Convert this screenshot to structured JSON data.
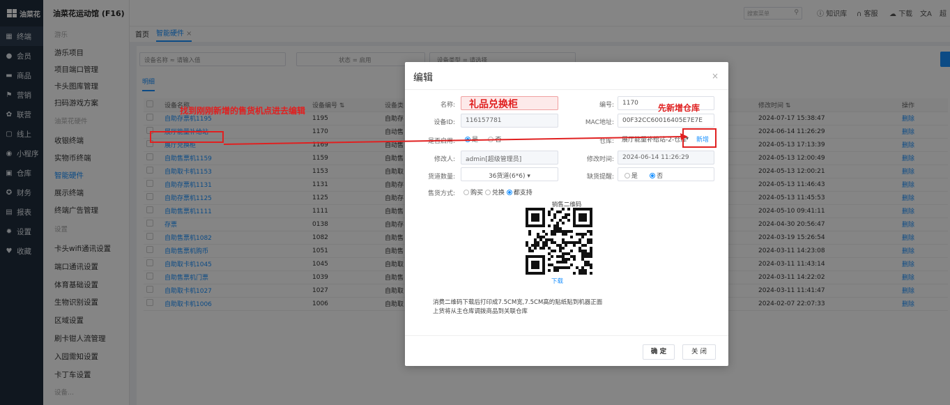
{
  "brand": {
    "name": "油菜花",
    "venue": "油菜花运动馆 (F16)"
  },
  "nav": [
    {
      "icon": "▦",
      "label": "终端"
    },
    {
      "icon": "●",
      "label": "会员"
    },
    {
      "icon": "▬",
      "label": "商品"
    },
    {
      "icon": "⚑",
      "label": "营销"
    },
    {
      "icon": "✿",
      "label": "联营"
    },
    {
      "icon": "▢",
      "label": "线上"
    },
    {
      "icon": "◉",
      "label": "小程序"
    },
    {
      "icon": "▣",
      "label": "仓库"
    },
    {
      "icon": "✪",
      "label": "财务"
    },
    {
      "icon": "▤",
      "label": "报表"
    },
    {
      "icon": "✹",
      "label": "设置"
    },
    {
      "icon": "♥",
      "label": "收藏"
    }
  ],
  "submenu": {
    "g1": "游乐",
    "g1_items": [
      "游乐项目",
      "项目端口管理",
      "卡头图库管理",
      "扫码游戏方案"
    ],
    "g2": "油菜花硬件",
    "g2_items": [
      "收银终端",
      "实物币终端",
      "智能硬件",
      "展示终端",
      "终端广告管理"
    ],
    "g3": "设置",
    "g3_items": [
      "卡头wifi通讯设置",
      "端口通讯设置",
      "体育基础设置",
      "生物识别设置",
      "区域设置",
      "刷卡钳人流管理",
      "入园需知设置",
      "卡丁车设置"
    ],
    "g4": "设备..."
  },
  "topbar": {
    "search_placeholder": "搜索菜单",
    "knowledge": "知识库",
    "service": "客服",
    "download": "下载",
    "extra": "超"
  },
  "tabs": [
    {
      "label": "首页"
    },
    {
      "label": "智能硬件"
    }
  ],
  "filters": {
    "name_label": "设备名称",
    "op1": "≈",
    "name_placeholder": "请输入值",
    "status_label": "状态",
    "op2": "=",
    "status_value": "启用",
    "type_label": "设备类型",
    "op3": "=",
    "type_placeholder": "请选择"
  },
  "subtab": "明细",
  "table": {
    "headers": [
      "",
      "设备名称",
      "设备编号 ⇅",
      "设备类",
      "修改时间 ⇅",
      "操作"
    ],
    "rows": [
      {
        "name": "自助存票机1195",
        "code": "1195",
        "type": "自助存",
        "time": "2024-07-17 15:38:47",
        "op": "删除"
      },
      {
        "name": "展厅能量补给站",
        "code": "1170",
        "type": "自动售",
        "time": "2024-06-14 11:26:29",
        "op": "删除"
      },
      {
        "name": "展厅兑换柜",
        "code": "1169",
        "type": "自动售",
        "time": "2024-05-13 17:13:39",
        "op": "删除"
      },
      {
        "name": "自助售票机1159",
        "code": "1159",
        "type": "自助售",
        "time": "2024-05-13 12:00:49",
        "op": "删除"
      },
      {
        "name": "自助取卡机1153",
        "code": "1153",
        "type": "自助取",
        "time": "2024-05-13 12:00:21",
        "op": "删除"
      },
      {
        "name": "自助存票机1131",
        "code": "1131",
        "type": "自助存",
        "time": "2024-05-13 11:46:43",
        "op": "删除"
      },
      {
        "name": "自助存票机1125",
        "code": "1125",
        "type": "自助存",
        "time": "2024-05-13 11:45:53",
        "op": "删除"
      },
      {
        "name": "自助售票机1111",
        "code": "1111",
        "type": "自助售",
        "time": "2024-05-10 09:41:11",
        "op": "删除"
      },
      {
        "name": "存票",
        "code": "0138",
        "type": "自助存",
        "time": "2024-04-30 20:56:47",
        "op": "删除"
      },
      {
        "name": "自助售票机1082",
        "code": "1082",
        "type": "自助售",
        "time": "2024-03-19 15:26:54",
        "op": "删除"
      },
      {
        "name": "自助售票机购币",
        "code": "1051",
        "type": "自助售",
        "time": "2024-03-11 14:23:08",
        "op": "删除"
      },
      {
        "name": "自助取卡机1045",
        "code": "1045",
        "type": "自助取",
        "time": "2024-03-11 11:43:14",
        "op": "删除"
      },
      {
        "name": "自助售票机门票",
        "code": "1039",
        "type": "自助售",
        "time": "2024-03-11 14:22:02",
        "op": "删除"
      },
      {
        "name": "自助取卡机1027",
        "code": "1027",
        "type": "自助取",
        "time": "2024-03-11 11:41:47",
        "op": "删除"
      },
      {
        "name": "自助取卡机1006",
        "code": "1006",
        "type": "自助取",
        "time": "2024-02-07 22:07:33",
        "op": "删除"
      }
    ]
  },
  "modal": {
    "title": "编辑",
    "name_label": "名称:",
    "name_value": "礼品兑换柜",
    "code_label": "编号:",
    "code_value": "1170",
    "id_label": "设备ID:",
    "id_value": "116157781",
    "mac_label": "MAC地址:",
    "mac_value": "00F32CC60016405E7E7E",
    "enable_label": "是否启用:",
    "yes": "是",
    "no": "否",
    "wh_label": "仓库:",
    "wh_value": "展厅能量补给站-2-仓库",
    "wh_add": "新增",
    "editor_label": "修改人:",
    "editor_value": "admin[超级管理员]",
    "mtime_label": "修改时间:",
    "mtime_value": "2024-06-14 11:26:29",
    "slots_label": "货道数量:",
    "slots_value": "36货道(6*6)",
    "shortage_label": "缺货提醒:",
    "sale_label": "售货方式:",
    "sale_opts": [
      "购买",
      "兑换",
      "都支持"
    ],
    "qr_caption": "销售二维码",
    "download": "下载",
    "note1": "消费二维码下载后打印成7.5CM宽,7.5CM高的贴纸贴到机器正面",
    "note2": "上货将从主仓库调拨商品到关联仓库",
    "ok": "确 定",
    "close": "关 闭"
  },
  "annotations": {
    "a1": "找到刚刚新增的售货机点进去编辑",
    "a2": "先新增仓库"
  },
  "colors": {
    "sidebar": "#1f2d3d",
    "accent": "#1890ff",
    "annotation": "#e02020"
  }
}
